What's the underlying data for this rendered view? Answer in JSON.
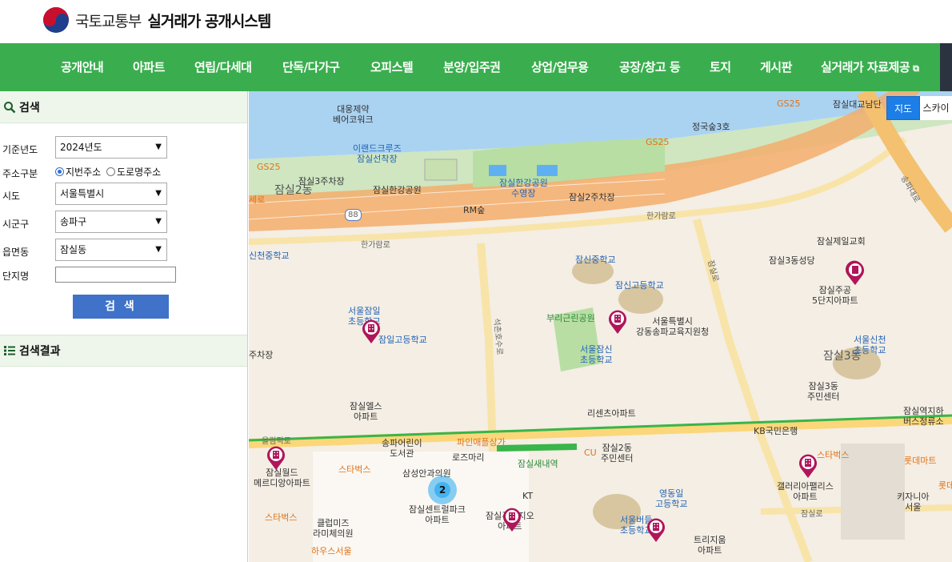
{
  "header": {
    "org_name": "국토교통부",
    "system_name": "실거래가 공개시스템"
  },
  "nav": {
    "items": [
      "공개안내",
      "아파트",
      "연립/다세대",
      "단독/다가구",
      "오피스텔",
      "분양/입주권",
      "상업/업무용",
      "공장/창고 등",
      "토지",
      "게시판",
      "실거래가 자료제공"
    ],
    "external_icon": "external-link-icon"
  },
  "search": {
    "title": "검색",
    "year_label": "기준년도",
    "year_value": "2024년도",
    "addr_type_label": "주소구분",
    "addr_options": [
      "지번주소",
      "도로명주소"
    ],
    "addr_selected": "지번주소",
    "sido_label": "시도",
    "sido_value": "서울특별시",
    "sigungu_label": "시군구",
    "sigungu_value": "송파구",
    "dong_label": "읍면동",
    "dong_value": "잠실동",
    "complex_label": "단지명",
    "complex_value": "",
    "button_label": "검 색"
  },
  "results": {
    "title": "검색결과"
  },
  "map": {
    "type_buttons": [
      "지도",
      "스카이"
    ],
    "selected_type": "지도",
    "cluster_count": "2",
    "labels": {
      "l1": "대웅제약\n베어코워크",
      "l2": "이랜드크루즈\n잠실선착장",
      "l3": "잠실3주차장",
      "l4": "잠실한강공원",
      "l5": "잠실한강공원\n수영장",
      "l6": "잠실2주차장",
      "l7": "RM숲",
      "l8": "정국숲3호",
      "l9": "잠실2동",
      "l10": "GS25",
      "l11": "GS25",
      "l12": "GS25",
      "l13": "잠실대교남단",
      "l14": "송파대로",
      "l15": "한가람로",
      "l16": "한가람로",
      "l17": "88",
      "l18": "신천중학교",
      "l19": "잠신중학교",
      "l20": "잠신고등학교",
      "l21": "잠실제일교회",
      "l22": "잠실3동성당",
      "l23": "잠실주공\n5단지아파트",
      "l24": "서울잠일\n초등학교",
      "l25": "잠일고등학교",
      "l26": "부리근린공원",
      "l27": "서울특별시\n강동송파교육지원청",
      "l28": "서울잠신\n초등학교",
      "l29": "서울신천\n초등학교",
      "l30": "잠실3동",
      "l31": "잠실3동\n주민센터",
      "l32": "잠실엘스\n아파트",
      "l33": "리센츠아파트",
      "l34": "KB국민은행",
      "l35": "잠실역지하\n버스정류소",
      "l36": "올림픽로",
      "l37": "송파어린이\n도서관",
      "l38": "파인애플상가",
      "l39": "로즈마리",
      "l40": "잠실새내역",
      "l41": "잠실2동\n주민센터",
      "l42": "CU",
      "l43": "스타벅스",
      "l44": "롯데마트",
      "l45": "잠실월드\n메르디앙아파트",
      "l46": "스타벅스",
      "l47": "삼성안과의원",
      "l48": "KT",
      "l49": "잠실센트럴파크\n아파트",
      "l50": "잠실푸르지오\n아파트",
      "l51": "영동일\n고등학교",
      "l52": "갤러리아팰리스\n아파트",
      "l53": "키자니아\n서울",
      "l54": "스타벅스",
      "l55": "클럽미즈\n라미체의원",
      "l56": "서울버들\n초등학교",
      "l57": "트리지움\n아파트",
      "l58": "잠실로",
      "l59": "하우스서울",
      "l60": "석촌호수로",
      "l61": "잠실로",
      "l62": "주차장",
      "l63": "세로",
      "l64": "롯데"
    }
  },
  "colors": {
    "nav_bg": "#3aae4e",
    "button_bg": "#3f72c8",
    "pin": "#b0155a",
    "river": "#aad3f2",
    "road": "#f3ad6c",
    "subway": "#39b54a"
  }
}
